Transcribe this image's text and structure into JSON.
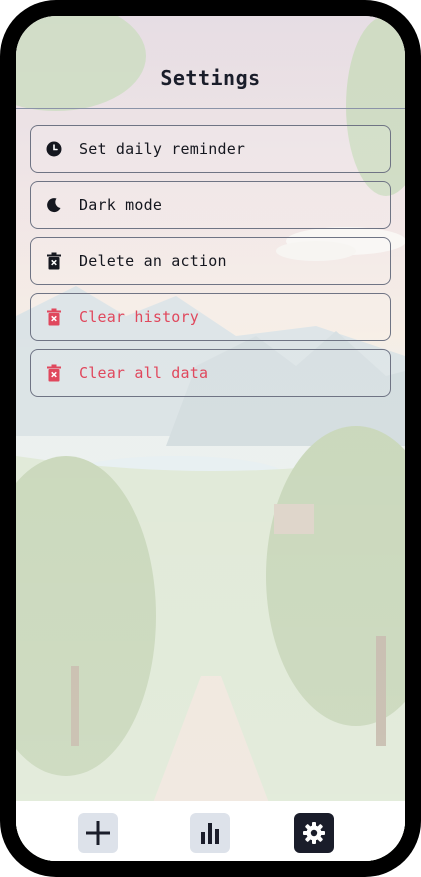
{
  "header": {
    "title": "Settings"
  },
  "menu": {
    "items": [
      {
        "label": "Set daily reminder",
        "icon": "clock-icon"
      },
      {
        "label": "Dark mode",
        "icon": "moon-icon"
      },
      {
        "label": "Delete an action",
        "icon": "trash-icon"
      },
      {
        "label": "Clear history",
        "icon": "trash-icon",
        "color": "#e0485d"
      },
      {
        "label": "Clear all data",
        "icon": "trash-icon",
        "color": "#e0485d"
      }
    ]
  },
  "tabbar": {
    "tabs": [
      {
        "icon": "plus-icon",
        "active": false
      },
      {
        "icon": "bar-chart-icon",
        "active": false
      },
      {
        "icon": "gear-icon",
        "active": true
      }
    ]
  },
  "colors": {
    "danger": "#e0485d",
    "text": "#15171f",
    "active_tab": "#1a1d2a",
    "inactive_tab": "#dde2ea"
  }
}
